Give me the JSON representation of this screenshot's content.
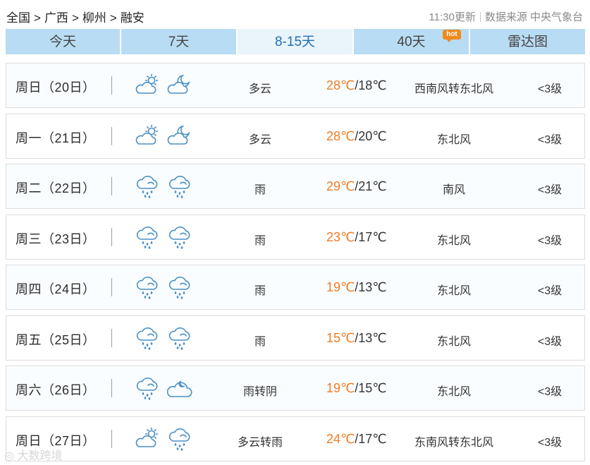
{
  "breadcrumb": {
    "items": [
      "全国",
      "广西",
      "柳州",
      "融安"
    ],
    "separator": ">"
  },
  "update": {
    "time_text": "11:30更新",
    "source_text": "数据来源 中央气象台"
  },
  "tabs": [
    {
      "label": "今天",
      "active": false
    },
    {
      "label": "7天",
      "active": false
    },
    {
      "label": "8-15天",
      "active": true
    },
    {
      "label": "40天",
      "active": false,
      "badge": "hot"
    },
    {
      "label": "雷达图",
      "active": false
    }
  ],
  "forecast": [
    {
      "day": "周日（20日）",
      "day_icon": "partly-cloudy-sun-icon",
      "night_icon": "partly-cloudy-moon-icon",
      "weather": "多云",
      "high": "28℃",
      "low": "/18℃",
      "wind": "西南风转东北风",
      "level": "<3级"
    },
    {
      "day": "周一（21日）",
      "day_icon": "partly-cloudy-sun-icon",
      "night_icon": "partly-cloudy-moon-icon",
      "weather": "多云",
      "high": "28℃",
      "low": "/20℃",
      "wind": "东北风",
      "level": "<3级"
    },
    {
      "day": "周二（22日）",
      "day_icon": "rain-cloud-icon",
      "night_icon": "rain-cloud-icon",
      "weather": "雨",
      "high": "29℃",
      "low": "/21℃",
      "wind": "南风",
      "level": "<3级"
    },
    {
      "day": "周三（23日）",
      "day_icon": "rain-cloud-icon",
      "night_icon": "rain-cloud-icon",
      "weather": "雨",
      "high": "23℃",
      "low": "/17℃",
      "wind": "东北风",
      "level": "<3级"
    },
    {
      "day": "周四（24日）",
      "day_icon": "rain-cloud-icon",
      "night_icon": "rain-cloud-icon",
      "weather": "雨",
      "high": "19℃",
      "low": "/13℃",
      "wind": "东北风",
      "level": "<3级"
    },
    {
      "day": "周五（25日）",
      "day_icon": "rain-cloud-icon",
      "night_icon": "rain-cloud-icon",
      "weather": "雨",
      "high": "15℃",
      "low": "/13℃",
      "wind": "东北风",
      "level": "<3级"
    },
    {
      "day": "周六（26日）",
      "day_icon": "rain-cloud-icon",
      "night_icon": "overcast-moon-icon",
      "weather": "雨转阴",
      "high": "19℃",
      "low": "/15℃",
      "wind": "东北风",
      "level": "<3级"
    },
    {
      "day": "周日（27日）",
      "day_icon": "partly-cloudy-sun-icon",
      "night_icon": "rain-cloud-icon",
      "weather": "多云转雨",
      "high": "24℃",
      "low": "/17℃",
      "wind": "东南风转东北风",
      "level": "<3级"
    }
  ],
  "watermark": "大数跨境",
  "colors": {
    "tab_bg": "#b8dcf3",
    "tab_active_bg": "#e9f4fb",
    "tab_active_text": "#1f6fb5",
    "high_temp": "#f07c23",
    "icon_stroke": "#4a8fc4",
    "hot_badge": "#f08a1b"
  }
}
